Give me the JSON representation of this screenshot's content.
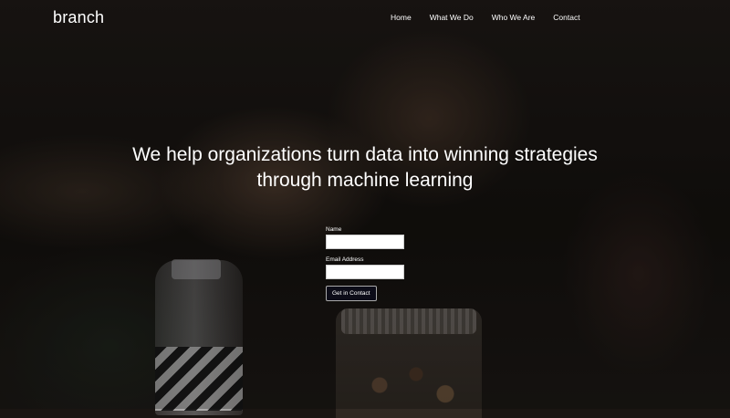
{
  "brand": {
    "logo": "branch"
  },
  "nav": {
    "items": [
      {
        "label": "Home"
      },
      {
        "label": "What We Do"
      },
      {
        "label": "Who We Are"
      },
      {
        "label": "Contact"
      }
    ]
  },
  "hero": {
    "headline_line1": "We help organizations turn data into winning strategies",
    "headline_line2": "through machine learning"
  },
  "form": {
    "name_label": "Name",
    "name_value": "",
    "email_label": "Email Address",
    "email_value": "",
    "submit_label": "Get in Contact"
  }
}
